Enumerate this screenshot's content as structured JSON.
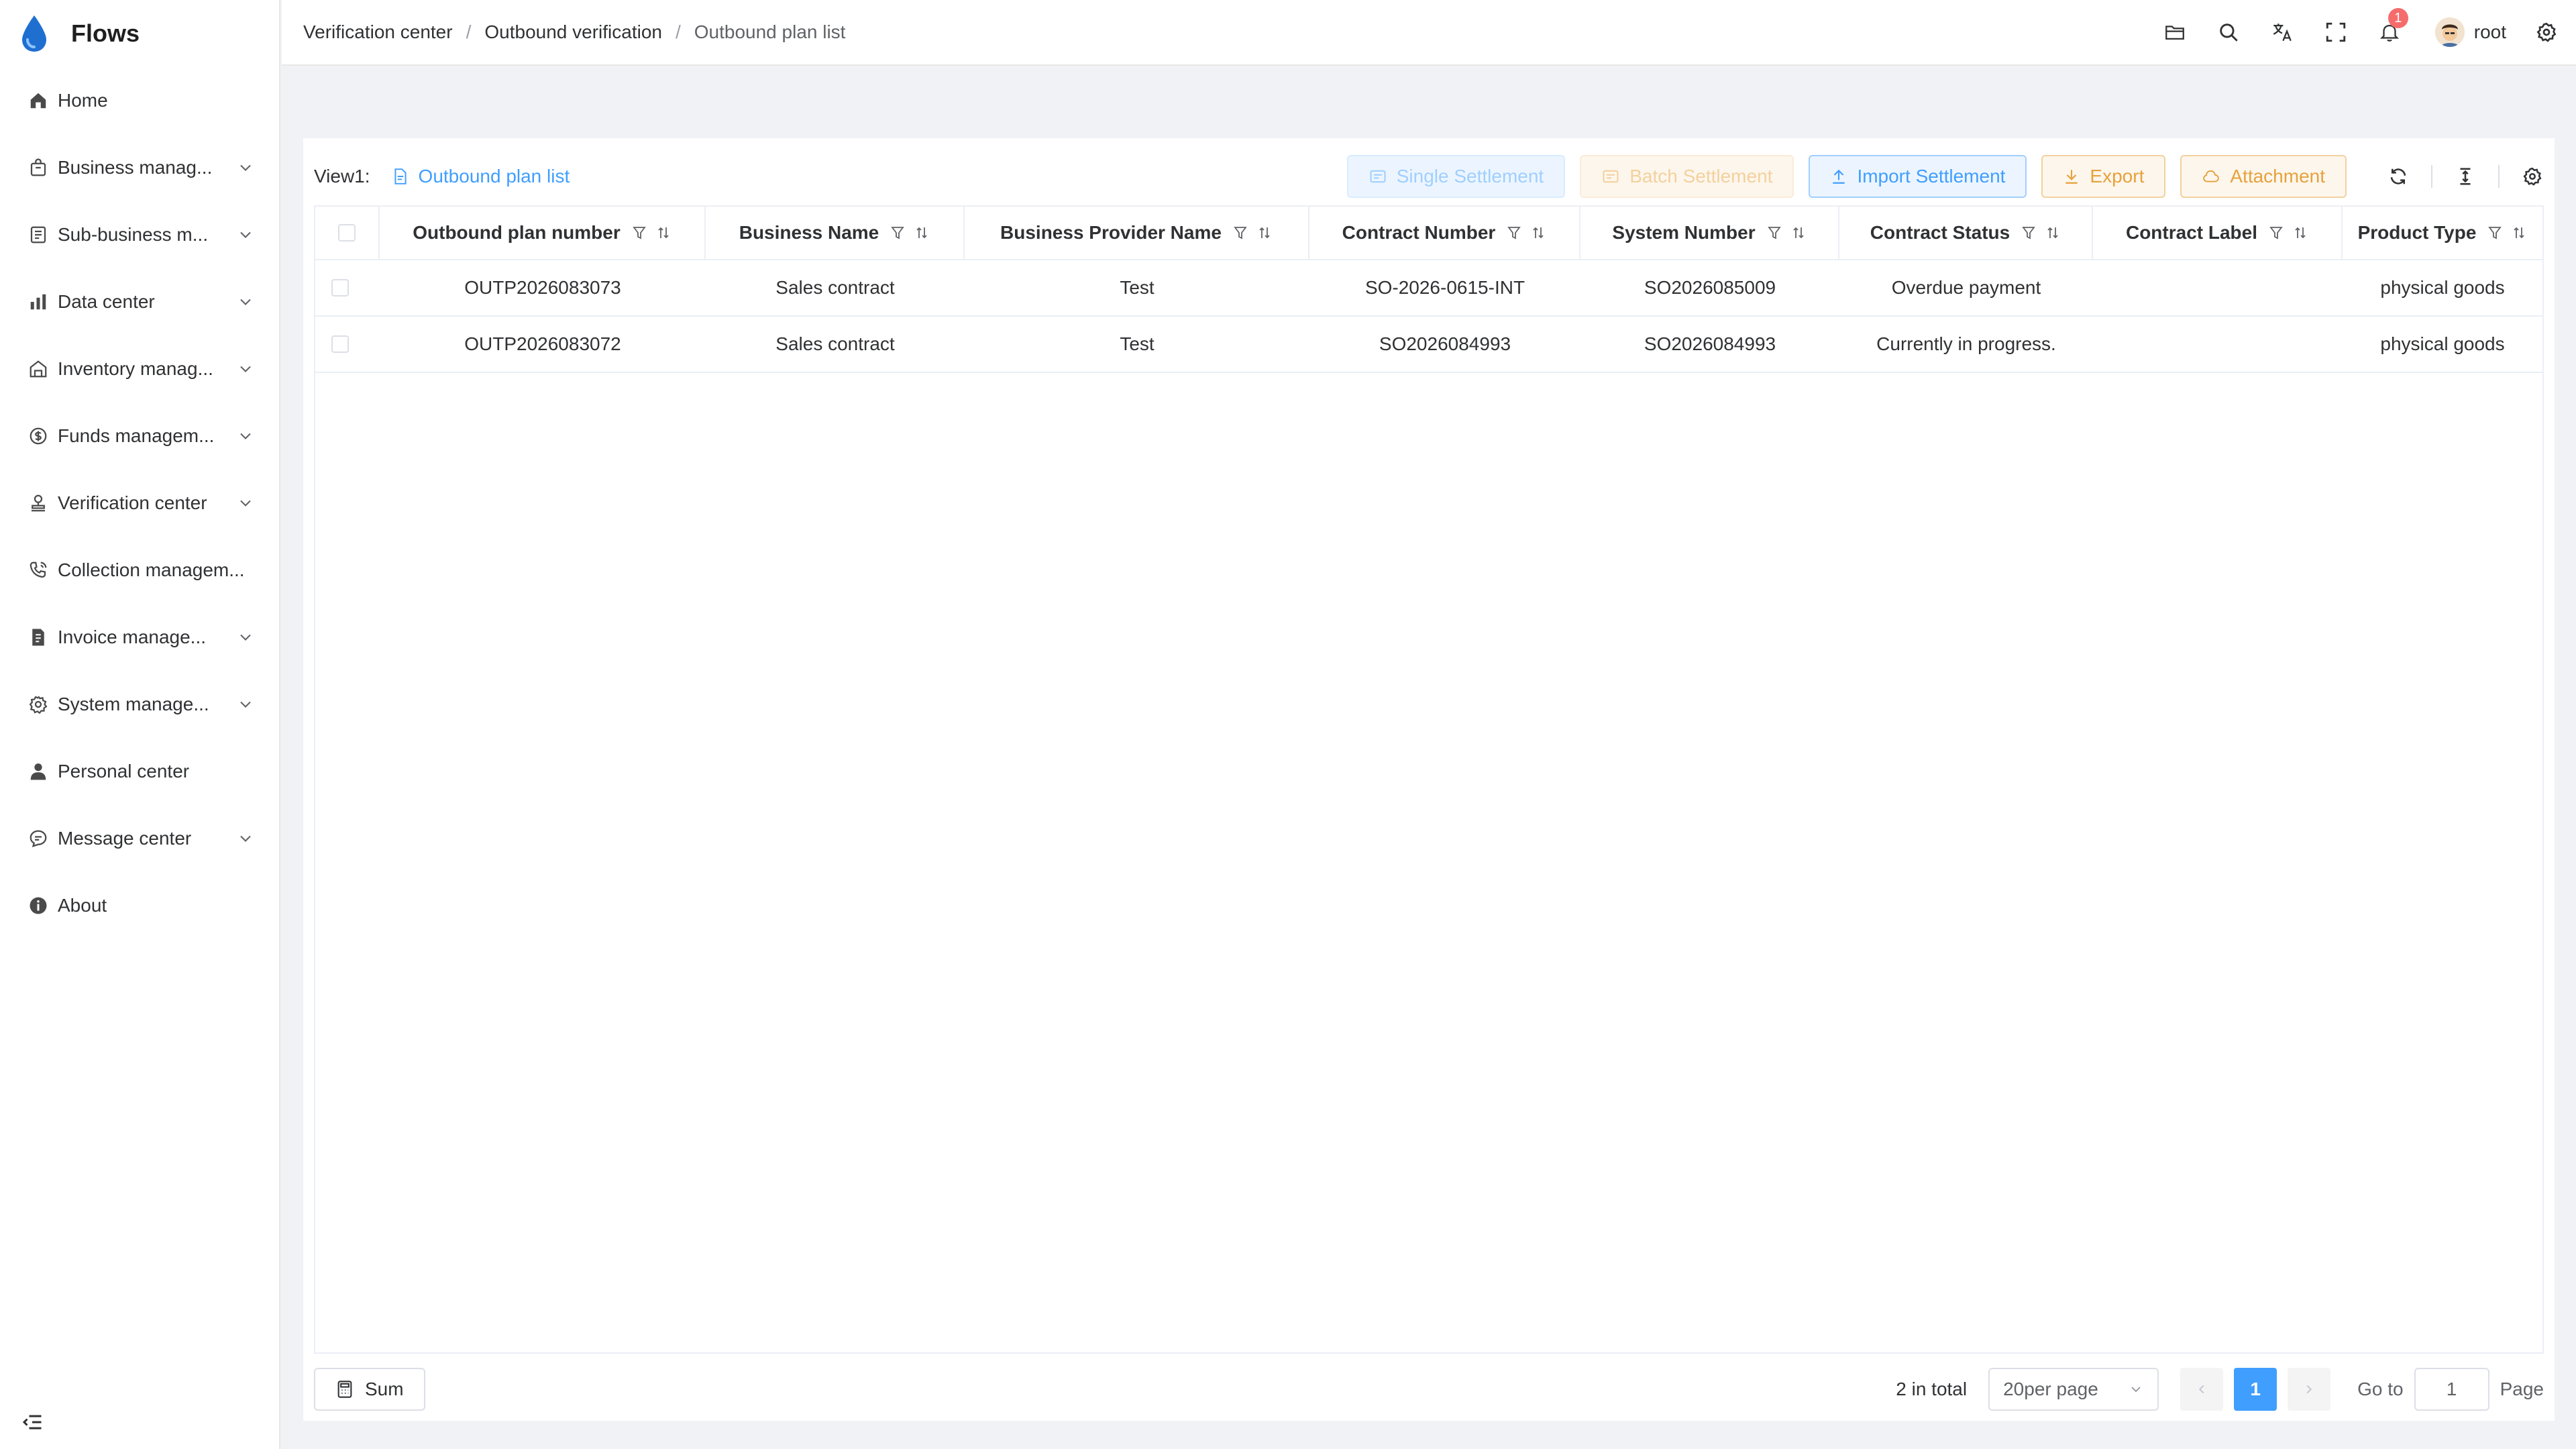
{
  "app": {
    "title": "Flows"
  },
  "sidebar": {
    "items": [
      {
        "label": "Home",
        "icon": "home-icon",
        "has_children": false
      },
      {
        "label": "Business manag...",
        "icon": "shopping-bag-icon",
        "has_children": true
      },
      {
        "label": "Sub-business m...",
        "icon": "list-icon",
        "has_children": true
      },
      {
        "label": "Data center",
        "icon": "bar-chart-icon",
        "has_children": true
      },
      {
        "label": "Inventory manag...",
        "icon": "warehouse-icon",
        "has_children": true
      },
      {
        "label": "Funds managem...",
        "icon": "coin-icon",
        "has_children": true
      },
      {
        "label": "Verification center",
        "icon": "stamp-icon",
        "has_children": true
      },
      {
        "label": "Collection managem...",
        "icon": "phone-call-icon",
        "has_children": false
      },
      {
        "label": "Invoice manage...",
        "icon": "invoice-icon",
        "has_children": true
      },
      {
        "label": "System manage...",
        "icon": "gear-icon",
        "has_children": true
      },
      {
        "label": "Personal center",
        "icon": "user-icon",
        "has_children": false
      },
      {
        "label": "Message center",
        "icon": "chat-icon",
        "has_children": true
      },
      {
        "label": "About",
        "icon": "info-icon",
        "has_children": false
      }
    ]
  },
  "header": {
    "breadcrumb": [
      "Verification center",
      "Outbound verification",
      "Outbound plan list"
    ],
    "notification_count": "1",
    "username": "root"
  },
  "toolbar": {
    "view_label": "View1:",
    "view_tab": "Outbound plan list",
    "buttons": {
      "single_settlement": "Single Settlement",
      "batch_settlement": "Batch Settlement",
      "import_settlement": "Import Settlement",
      "export": "Export",
      "attachment": "Attachment"
    }
  },
  "table": {
    "columns": [
      "Outbound plan number",
      "Business Name",
      "Business Provider Name",
      "Contract Number",
      "System Number",
      "Contract Status",
      "Contract Label",
      "Product Type"
    ],
    "rows": [
      [
        "OUTP2026083073",
        "Sales contract",
        "Test",
        "SO-2026-0615-INT",
        "SO2026085009",
        "Overdue payment",
        "",
        "physical goods"
      ],
      [
        "OUTP2026083072",
        "Sales contract",
        "Test",
        "SO2026084993",
        "SO2026084993",
        "Currently in progress.",
        "",
        "physical goods"
      ]
    ]
  },
  "footer": {
    "sum_label": "Sum",
    "total": "2 in total",
    "page_size": "20per page",
    "current_page": "1",
    "goto_label": "Go to",
    "goto_value": "1",
    "page_label": "Page"
  },
  "colors": {
    "accent": "#409eff",
    "warning": "#e6a23c",
    "badge": "#f56c6c"
  }
}
